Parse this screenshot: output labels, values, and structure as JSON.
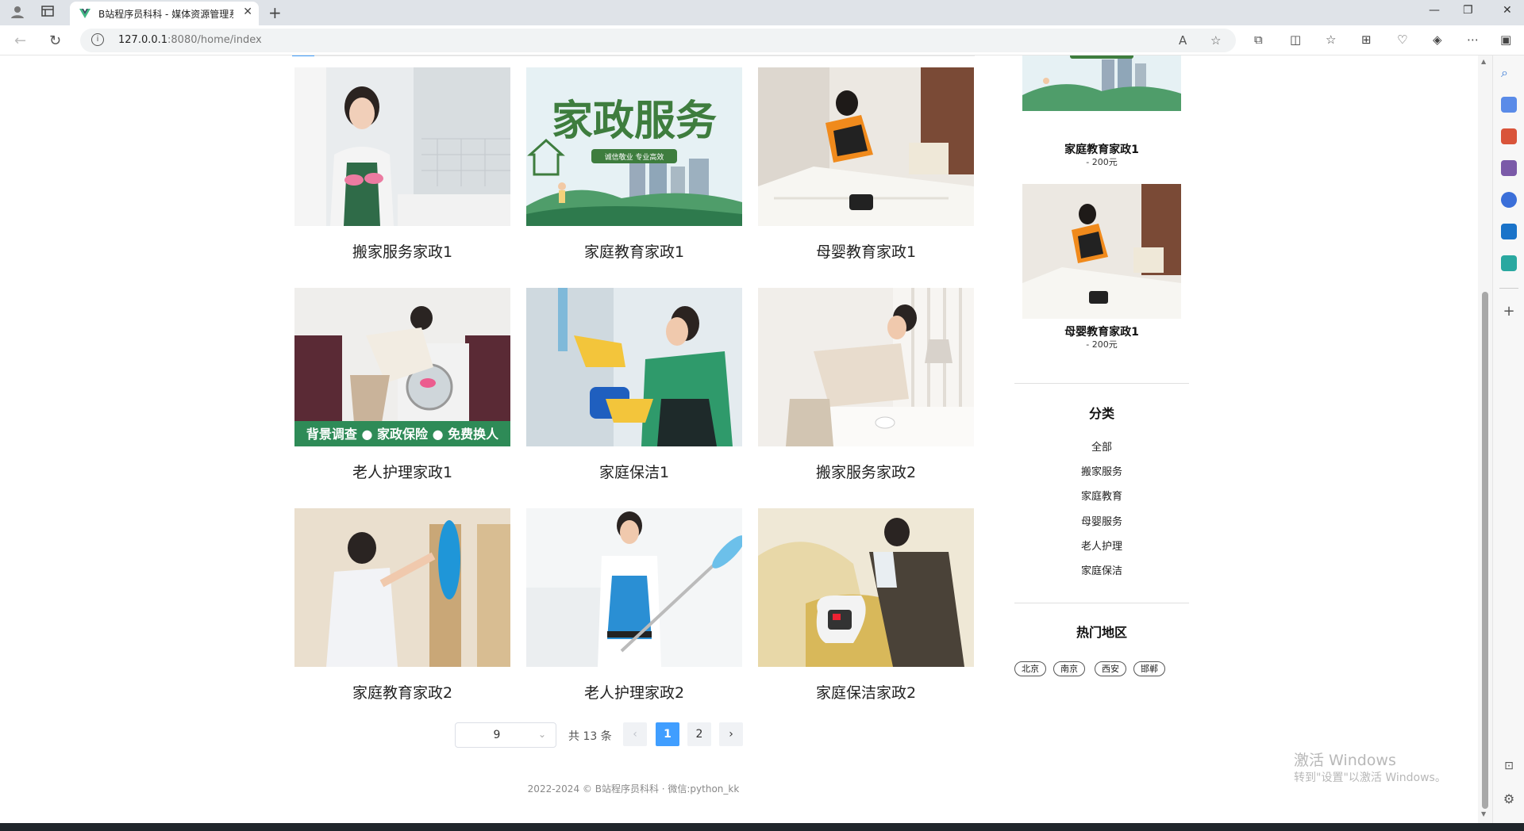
{
  "browser": {
    "tab_title": "B站程序员科科 - 媒体资源管理系",
    "url_host": "127.0.0.1",
    "url_path": ":8080/home/index"
  },
  "cards": [
    {
      "name": "搬家服务家政1",
      "image": "maid-apron-kitchen"
    },
    {
      "name": "家庭教育家政1",
      "image": "home-service-banner"
    },
    {
      "name": "母婴教育家政1",
      "image": "worker-making-bed"
    },
    {
      "name": "老人护理家政1",
      "image": "worker-washing-machine",
      "image_text": "背景调查 ● 家政保险 ● 免费换人"
    },
    {
      "name": "家庭保洁1",
      "image": "worker-cleaning-window"
    },
    {
      "name": "搬家服务家政2",
      "image": "worker-smoothing-sheet"
    },
    {
      "name": "家庭教育家政2",
      "image": "worker-dusting-shelf"
    },
    {
      "name": "老人护理家政2",
      "image": "worker-blue-apron"
    },
    {
      "name": "家庭保洁家政2",
      "image": "worker-vacuum-sofa"
    }
  ],
  "banner": {
    "big": "家政服务",
    "small": "诚信敬业 专业高效"
  },
  "recommended": [
    {
      "name": "家庭教育家政1",
      "price": "- 200元"
    },
    {
      "name": "母婴教育家政1",
      "price": "- 200元"
    }
  ],
  "category": {
    "title": "分类",
    "items": [
      "全部",
      "搬家服务",
      "家庭教育",
      "母婴服务",
      "老人护理",
      "家庭保洁"
    ]
  },
  "regions": {
    "title": "热门地区",
    "items": [
      "北京",
      "南京",
      "西安",
      "邯郸"
    ]
  },
  "pagination": {
    "page_size": "9",
    "total": "共 13 条",
    "pages": [
      "1",
      "2"
    ],
    "current": "1"
  },
  "footer": "2022-2024 © B站程序员科科 · 微信:python_kk",
  "watermark": {
    "line1": "激活 Windows",
    "line2": "转到\"设置\"以激活 Windows。"
  },
  "colors": {
    "accent": "#409eff",
    "banner_green": "#3e7d3e"
  }
}
